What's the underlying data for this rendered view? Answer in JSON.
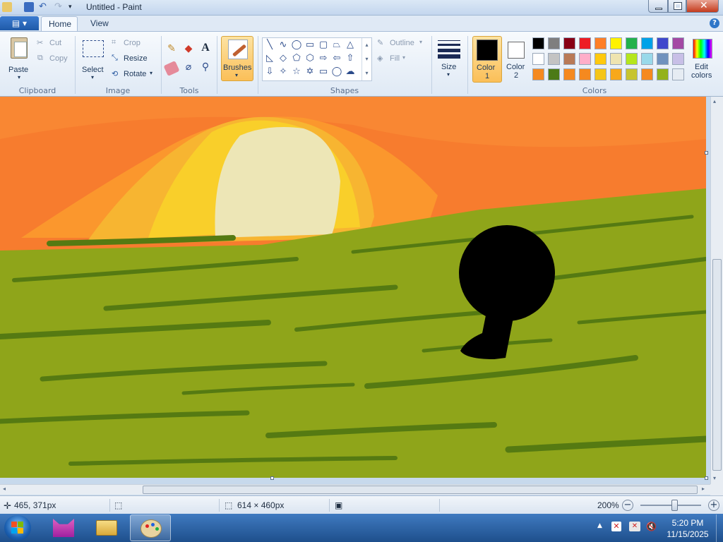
{
  "window": {
    "title": "Untitled - Paint",
    "minimize_icon": "minimize-icon",
    "maximize_icon": "restore-icon",
    "close_icon": "close-icon"
  },
  "tabs": [
    {
      "label": "Home",
      "active": true
    },
    {
      "label": "View",
      "active": false
    }
  ],
  "ribbon": {
    "clipboard": {
      "group": "Clipboard",
      "paste": "Paste",
      "cut": "Cut",
      "copy": "Copy"
    },
    "image": {
      "group": "Image",
      "select": "Select",
      "crop": "Crop",
      "resize": "Resize",
      "rotate": "Rotate"
    },
    "tools": {
      "group": "Tools"
    },
    "brushes": "Brushes",
    "shapes": {
      "group": "Shapes",
      "outline": "Outline",
      "fill": "Fill"
    },
    "size": "Size",
    "color1": {
      "label": "Color",
      "num": "1",
      "value": "#000000"
    },
    "color2": {
      "label": "Color",
      "num": "2",
      "value": "#ffffff"
    },
    "colors_group": "Colors",
    "edit_colors": {
      "line1": "Edit",
      "line2": "colors"
    },
    "palette": [
      [
        "#000000",
        "#7f7f7f",
        "#880015",
        "#ed1c24",
        "#ff7f27",
        "#fff200",
        "#22b14c",
        "#00a2e8",
        "#3f48cc",
        "#a349a4"
      ],
      [
        "#ffffff",
        "#c3c3c3",
        "#b97a57",
        "#ffaec9",
        "#ffc90e",
        "#efe4b0",
        "#b5e61d",
        "#99d9ea",
        "#7092be",
        "#c8bfe7"
      ],
      [
        "#f5891f",
        "#4c7a16",
        "#f5891f",
        "#f5891f",
        "#f5c518",
        "#f7a81b",
        "#c7c430",
        "#f5891f",
        "#93b21b",
        "#e6ecf3"
      ]
    ]
  },
  "status": {
    "cursor_pos": "465, 371px",
    "image_size": "614 × 460px",
    "zoom": "200%"
  },
  "taskbar": {
    "time": "5:20 PM",
    "date": "11/15/2025"
  }
}
